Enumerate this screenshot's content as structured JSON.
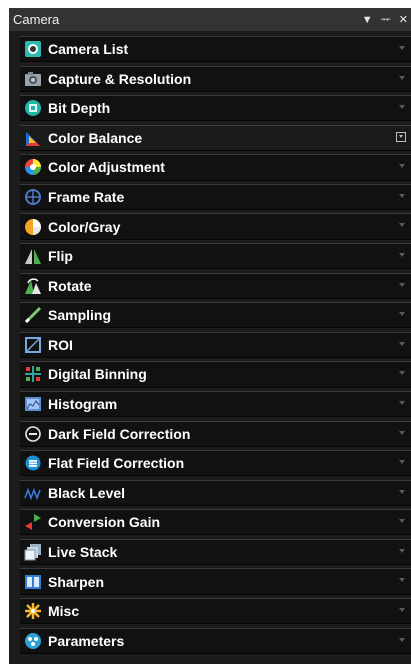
{
  "panel": {
    "title": "Camera",
    "buttons": {
      "dropdown": "▼",
      "pin": "ᅲ",
      "close": "✕"
    }
  },
  "sections": [
    {
      "label": "Camera List",
      "icon": "camera-list-icon"
    },
    {
      "label": "Capture & Resolution",
      "icon": "capture-icon"
    },
    {
      "label": "Bit Depth",
      "icon": "bit-depth-icon"
    },
    {
      "label": "Color Balance",
      "icon": "color-balance-icon",
      "expanded": true
    },
    {
      "label": "Color Adjustment",
      "icon": "color-adjustment-icon"
    },
    {
      "label": "Frame Rate",
      "icon": "frame-rate-icon"
    },
    {
      "label": "Color/Gray",
      "icon": "color-gray-icon"
    },
    {
      "label": "Flip",
      "icon": "flip-icon"
    },
    {
      "label": "Rotate",
      "icon": "rotate-icon"
    },
    {
      "label": "Sampling",
      "icon": "sampling-icon"
    },
    {
      "label": "ROI",
      "icon": "roi-icon"
    },
    {
      "label": "Digital Binning",
      "icon": "digital-binning-icon"
    },
    {
      "label": "Histogram",
      "icon": "histogram-icon"
    },
    {
      "label": "Dark Field Correction",
      "icon": "dark-field-icon"
    },
    {
      "label": "Flat Field Correction",
      "icon": "flat-field-icon"
    },
    {
      "label": "Black Level",
      "icon": "black-level-icon"
    },
    {
      "label": "Conversion Gain",
      "icon": "conversion-gain-icon"
    },
    {
      "label": "Live Stack",
      "icon": "live-stack-icon"
    },
    {
      "label": "Sharpen",
      "icon": "sharpen-icon"
    },
    {
      "label": "Misc",
      "icon": "misc-icon"
    },
    {
      "label": "Parameters",
      "icon": "parameters-icon"
    }
  ]
}
